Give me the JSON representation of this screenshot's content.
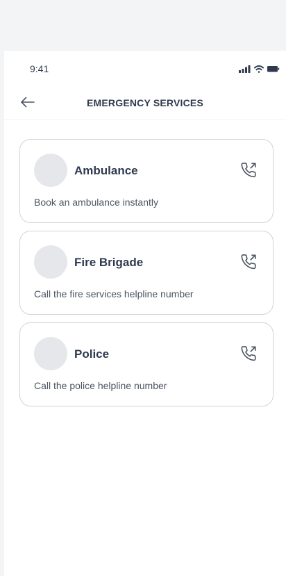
{
  "status_bar": {
    "time": "9:41"
  },
  "header": {
    "title": "EMERGENCY SERVICES"
  },
  "services": [
    {
      "title": "Ambulance",
      "description": "Book an ambulance instantly"
    },
    {
      "title": "Fire Brigade",
      "description": "Call the fire services helpline number"
    },
    {
      "title": "Police",
      "description": "Call the police helpline number"
    }
  ],
  "colors": {
    "text_primary": "#2f3a4f",
    "card_border": "#cfd4dc",
    "avatar_bg": "#e5e7eb",
    "page_bg": "#f3f4f6"
  },
  "icons": {
    "back": "arrow-left-icon",
    "call": "phone-outgoing-icon",
    "signal": "signal-icon",
    "wifi": "wifi-icon",
    "battery": "battery-icon"
  }
}
